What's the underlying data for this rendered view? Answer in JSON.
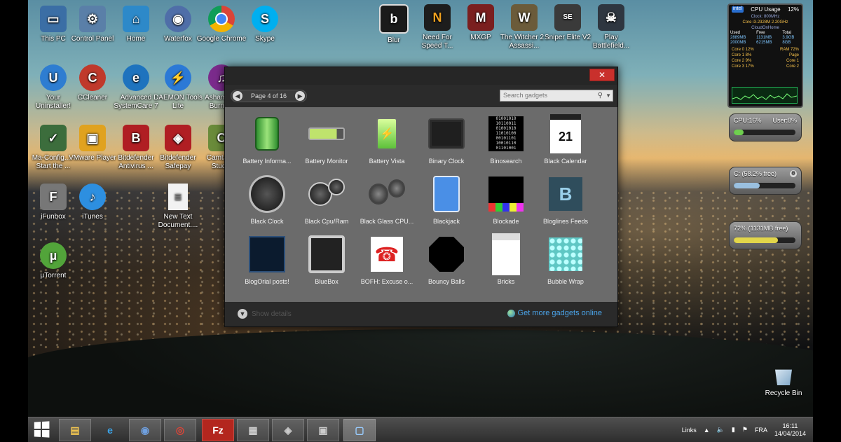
{
  "desktop_icons": [
    {
      "label": "This PC",
      "icon": "pc-icon",
      "color": "#3b6ea5"
    },
    {
      "label": "Control Panel",
      "icon": "control-panel-icon",
      "color": "#5a7fa8"
    },
    {
      "label": "Home",
      "icon": "home-icon",
      "color": "#2d89c9"
    },
    {
      "label": "Waterfox",
      "icon": "waterfox-icon",
      "color": "#4f6ea8"
    },
    {
      "label": "Google Chrome",
      "icon": "chrome-icon",
      "color": "#db4437"
    },
    {
      "label": "Skype",
      "icon": "skype-icon",
      "color": "#00aff0"
    },
    {
      "label": "Your Uninstaller!",
      "icon": "uninstaller-icon",
      "color": "#2e7dd1"
    },
    {
      "label": "CCleaner",
      "icon": "ccleaner-icon",
      "color": "#c0392b"
    },
    {
      "label": "Advanced SystemCare 7",
      "icon": "systemcare-icon",
      "color": "#1e73be"
    },
    {
      "label": "DAEMON Tools Lite",
      "icon": "daemon-tools-icon",
      "color": "#2b79d6"
    },
    {
      "label": "Ashampoo Burning",
      "icon": "ashampoo-icon",
      "color": "#7b2b8c"
    },
    {
      "label": "Ma-Config... - Start the ...",
      "icon": "maconfig-icon",
      "color": "#3c6d3c"
    },
    {
      "label": "VMware Player",
      "icon": "vmware-icon",
      "color": "#e0a21f"
    },
    {
      "label": "Bitdefender Antivirus ...",
      "icon": "bitdefender-icon",
      "color": "#b01e23"
    },
    {
      "label": "Bitdefender Safepay",
      "icon": "safepay-icon",
      "color": "#b01e23"
    },
    {
      "label": "Camtasia Studio",
      "icon": "camtasia-icon",
      "color": "#6a8b3a"
    },
    {
      "label": "iFunbox",
      "icon": "ifunbox-icon",
      "color": "#777777"
    },
    {
      "label": "iTunes",
      "icon": "itunes-icon",
      "color": "#2d8fe0"
    },
    {
      "label": "New Text Document....",
      "icon": "text-document-icon",
      "color": "#f2f2f2"
    },
    {
      "label": "µTorrent",
      "icon": "utorrent-icon",
      "color": "#52a43a"
    }
  ],
  "pinned_games": [
    {
      "label": "Blur",
      "icon": "blur-icon"
    },
    {
      "label": "Need For Speed T...",
      "icon": "nfs-icon"
    },
    {
      "label": "MXGP",
      "icon": "mxgp-icon"
    },
    {
      "label": "The Witcher 2 - Assassi...",
      "icon": "witcher-icon"
    },
    {
      "label": "Sniper Elite V2",
      "icon": "sniper-elite-icon"
    },
    {
      "label": "Play Battlefield...",
      "icon": "battlefield-icon"
    }
  ],
  "gadget_window": {
    "close_label": "✕",
    "page_label": "Page 4 of 16",
    "search_placeholder": "Search gadgets",
    "gadgets": [
      {
        "label": "Battery Informa...",
        "icon": "battery-info-icon"
      },
      {
        "label": "Battery Monitor",
        "icon": "battery-monitor-icon"
      },
      {
        "label": "Battery Vista",
        "icon": "battery-vista-icon"
      },
      {
        "label": "Binary Clock",
        "icon": "binary-clock-icon"
      },
      {
        "label": "Binosearch",
        "icon": "binosearch-icon"
      },
      {
        "label": "Black Calendar",
        "icon": "black-calendar-icon"
      },
      {
        "label": "Black Clock",
        "icon": "black-clock-icon"
      },
      {
        "label": "Black Cpu/Ram",
        "icon": "black-cpu-ram-icon"
      },
      {
        "label": "Black Glass CPU...",
        "icon": "black-glass-cpu-icon"
      },
      {
        "label": "Blackjack",
        "icon": "blackjack-icon"
      },
      {
        "label": "Blockade",
        "icon": "blockade-icon"
      },
      {
        "label": "Bloglines Feeds",
        "icon": "bloglines-icon"
      },
      {
        "label": "BlogOrial posts!",
        "icon": "blogorial-icon"
      },
      {
        "label": "BlueBox",
        "icon": "bluebox-icon"
      },
      {
        "label": "BOFH: Excuse o...",
        "icon": "bofh-icon"
      },
      {
        "label": "Bouncy Balls",
        "icon": "bouncy-balls-icon"
      },
      {
        "label": "Bricks",
        "icon": "bricks-icon"
      },
      {
        "label": "Bubble Wrap",
        "icon": "bubble-wrap-icon"
      }
    ],
    "calendar_day": "21",
    "hide_details_label": "Show details",
    "more_link_label": "Get more gadgets online"
  },
  "cpu_gadget": {
    "brand": "intel",
    "title": "CPU Usage",
    "percent": "12%",
    "clock": "Clock: 800MHz",
    "core_info": "Core i3-2328M 2.20GHz",
    "host": "CloudOnHome",
    "table_head": [
      "Used",
      "Free",
      "Total"
    ],
    "rows": [
      [
        "2889MB",
        "1131MB",
        "3.9GB"
      ],
      [
        "2000MB",
        "6215MB",
        "8GB"
      ]
    ],
    "cores": [
      "Core 0  12%",
      "Core 1  8%",
      "Core 2  9%",
      "Core 3  17%"
    ],
    "labels": [
      "RAM 72%",
      "Page",
      "Core 1",
      "Core 2"
    ]
  },
  "meters": [
    {
      "left": "CPU:16%",
      "right": "User:8%",
      "fill": 0.16,
      "color": "#6fcf4f"
    },
    {
      "left": "C: (58.2% free)",
      "right": "",
      "fill": 0.42,
      "color": "#9ac0e0"
    },
    {
      "left": "72% (1131MB free)",
      "right": "",
      "fill": 0.72,
      "color": "#e2d64a"
    }
  ],
  "recycle_bin_label": "Recycle Bin",
  "taskbar": {
    "items": [
      "file-explorer-icon",
      "internet-explorer-icon",
      "waterfox-icon",
      "chrome-icon",
      "filezilla-icon",
      "app-icon-1",
      "app-icon-2",
      "app-icon-3",
      "gadgets-icon"
    ],
    "links_label": "Links",
    "lang": "FRA",
    "time": "16:11",
    "date": "14/04/2014"
  }
}
